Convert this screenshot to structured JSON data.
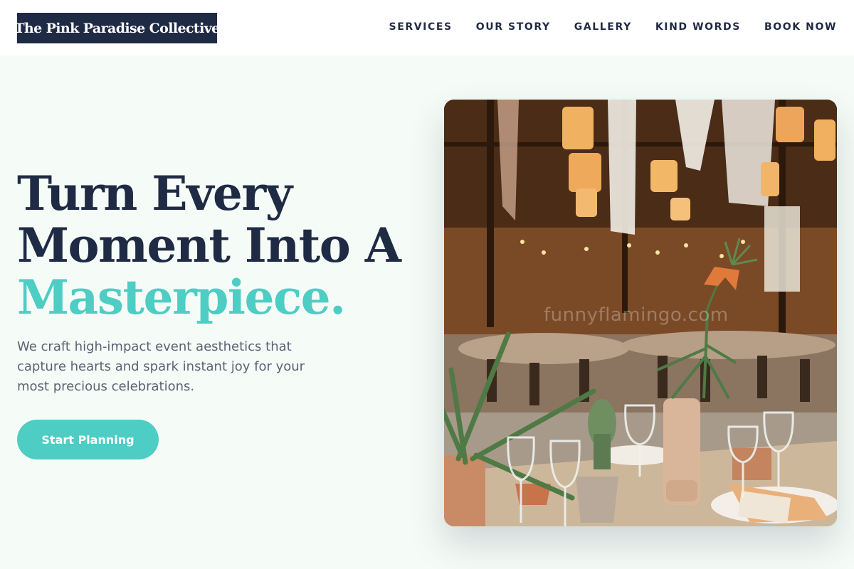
{
  "brand": {
    "name": "The Pink Paradise Collective"
  },
  "nav": {
    "items": [
      "SERVICES",
      "OUR STORY",
      "GALLERY",
      "KIND WORDS",
      "BOOK NOW"
    ]
  },
  "hero": {
    "title_line1": "Turn Every",
    "title_line2": "Moment Into A",
    "title_accent": "Masterpiece.",
    "subtitle": "We craft high-impact event aesthetics that capture hearts and spark instant joy for your most precious celebrations.",
    "cta_label": "Start Planning",
    "image_watermark": "funnyflamingo.com"
  },
  "colors": {
    "navy": "#1f2a44",
    "accent": "#4ecdc4",
    "background": "#f5fcf7",
    "body_text": "#5c6274"
  }
}
